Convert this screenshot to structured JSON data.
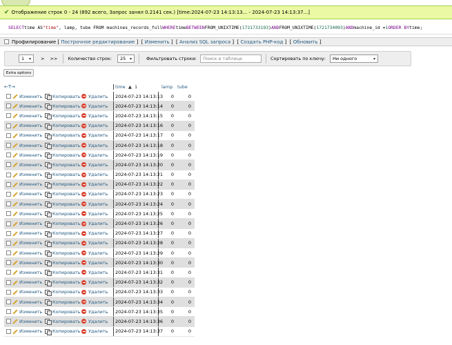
{
  "success": {
    "text_main": "Отображение строк 0 - 24 (892 всего, Запрос занял 0.2141 сек.) [time: ",
    "range": "2024-07-23 14:13:13... - 2024-07-23 14:13:37...",
    "tail": "]"
  },
  "sql": {
    "p1": "SELECT",
    "p2": " time AS ",
    "p3": "\"time\"",
    "p4": ", lamp, tube FROM machines_records_full ",
    "p5": "WHERE",
    "p6": " time ",
    "p7": "BETWEEN",
    "p8": " FROM_UNIXTIME(",
    "p9": "1721733193",
    "p10": ") ",
    "p11": "AND",
    "p12": " FROM_UNIXTIME(",
    "p13": "1721734093",
    "p14": ") ",
    "p15": "AND",
    "p16": " machine_id = ",
    "p17": "1",
    "p18": " ",
    "p19": "ORDER BY",
    "p20": " time;"
  },
  "linkbar": {
    "profiling": "Профилирование",
    "inline_edit": "Построчное редактирование",
    "edit": "Изменить",
    "analyze": "Анализ SQL запроса",
    "create_php": "Создать PHP-код",
    "refresh": "Обновить"
  },
  "nav": {
    "page_value": "1",
    "next": ">",
    "last": ">>",
    "count_label": "Количество строк:",
    "count_value": "25",
    "filter_label": "Фильтровать строки:",
    "filter_placeholder": "Поиск в таблице",
    "sort_label": "Сортировать по ключу:",
    "sort_value": "Ни одного"
  },
  "extra_options": "Extra options",
  "table": {
    "arrows": "←T→",
    "col_time": "time",
    "sort_arrow": "1",
    "col_lamp": "lamp",
    "col_tube": "tube",
    "edit_label": "Изменить",
    "copy_label": "Копировать",
    "delete_label": "Удалить",
    "rows": [
      {
        "time": "2024-07-23 14:13:13",
        "lamp": "0",
        "tube": "0"
      },
      {
        "time": "2024-07-23 14:13:14",
        "lamp": "0",
        "tube": "0"
      },
      {
        "time": "2024-07-23 14:13:15",
        "lamp": "0",
        "tube": "0"
      },
      {
        "time": "2024-07-23 14:13:16",
        "lamp": "0",
        "tube": "0"
      },
      {
        "time": "2024-07-23 14:13:17",
        "lamp": "0",
        "tube": "0"
      },
      {
        "time": "2024-07-23 14:13:18",
        "lamp": "0",
        "tube": "0"
      },
      {
        "time": "2024-07-23 14:13:19",
        "lamp": "0",
        "tube": "0"
      },
      {
        "time": "2024-07-23 14:13:20",
        "lamp": "0",
        "tube": "0"
      },
      {
        "time": "2024-07-23 14:13:21",
        "lamp": "0",
        "tube": "0"
      },
      {
        "time": "2024-07-23 14:13:22",
        "lamp": "0",
        "tube": "0"
      },
      {
        "time": "2024-07-23 14:13:23",
        "lamp": "0",
        "tube": "0"
      },
      {
        "time": "2024-07-23 14:13:24",
        "lamp": "0",
        "tube": "0"
      },
      {
        "time": "2024-07-23 14:13:25",
        "lamp": "0",
        "tube": "0"
      },
      {
        "time": "2024-07-23 14:13:26",
        "lamp": "0",
        "tube": "0"
      },
      {
        "time": "2024-07-23 14:13:27",
        "lamp": "0",
        "tube": "0"
      },
      {
        "time": "2024-07-23 14:13:28",
        "lamp": "0",
        "tube": "0"
      },
      {
        "time": "2024-07-23 14:13:29",
        "lamp": "0",
        "tube": "0"
      },
      {
        "time": "2024-07-23 14:13:30",
        "lamp": "0",
        "tube": "0"
      },
      {
        "time": "2024-07-23 14:13:31",
        "lamp": "0",
        "tube": "0"
      },
      {
        "time": "2024-07-23 14:13:32",
        "lamp": "0",
        "tube": "0"
      },
      {
        "time": "2024-07-23 14:13:33",
        "lamp": "0",
        "tube": "0"
      },
      {
        "time": "2024-07-23 14:13:34",
        "lamp": "0",
        "tube": "0"
      },
      {
        "time": "2024-07-23 14:13:35",
        "lamp": "0",
        "tube": "0"
      },
      {
        "time": "2024-07-23 14:13:36",
        "lamp": "0",
        "tube": "0"
      },
      {
        "time": "2024-07-23 14:13:37",
        "lamp": "0",
        "tube": "0"
      }
    ]
  }
}
